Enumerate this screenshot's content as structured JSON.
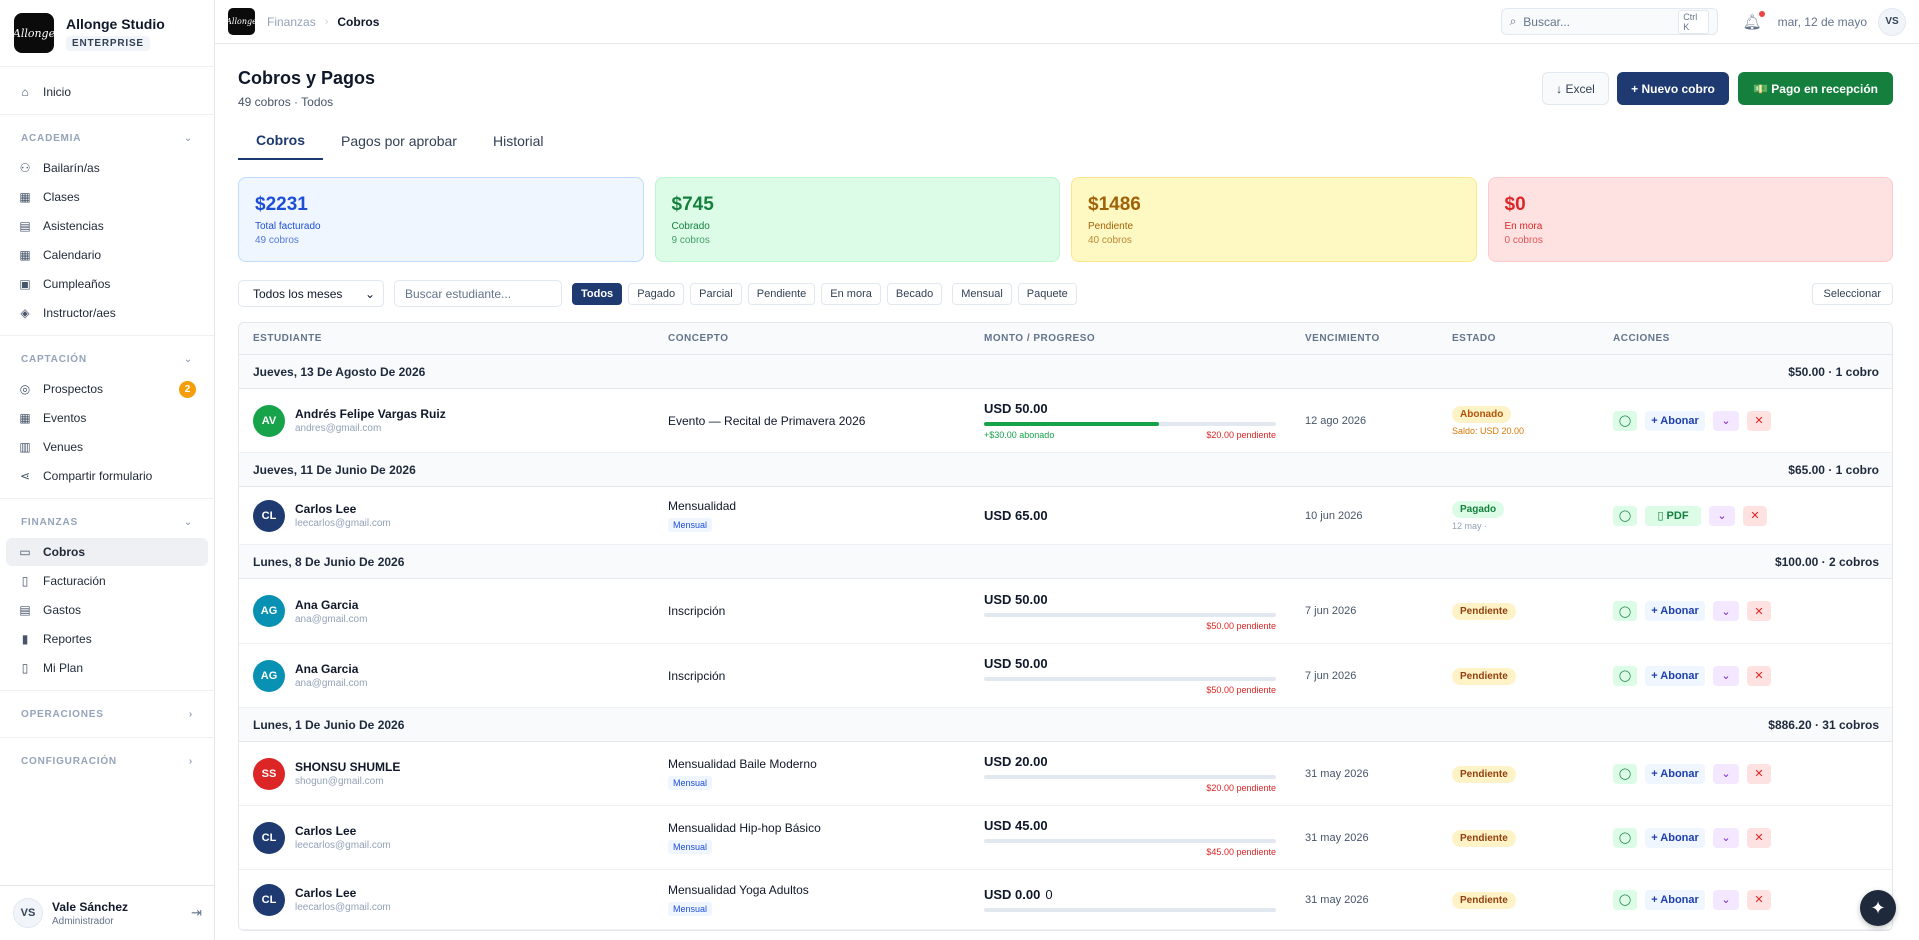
{
  "sidebar": {
    "brand": {
      "logo": "Allonge",
      "name": "Allonge Studio",
      "plan": "ENTERPRISE"
    },
    "home": "Inicio",
    "academia": {
      "title": "ACADEMIA",
      "items": [
        "Bailarín/as",
        "Clases",
        "Asistencias",
        "Calendario",
        "Cumpleaños",
        "Instructor/aes"
      ]
    },
    "captacion": {
      "title": "CAPTACIÓN",
      "items": [
        "Prospectos",
        "Eventos",
        "Venues",
        "Compartir formulario"
      ],
      "prospectos_badge": "2"
    },
    "finanzas": {
      "title": "FINANZAS",
      "items": [
        "Cobros",
        "Facturación",
        "Gastos",
        "Reportes",
        "Mi Plan"
      ]
    },
    "operaciones": "OPERACIONES",
    "configuracion": "CONFIGURACIÓN",
    "user": {
      "initials": "VS",
      "name": "Vale Sánchez",
      "role": "Administrador"
    }
  },
  "topbar": {
    "logo": "Allonge",
    "breadcrumb": [
      "Finanzas",
      "Cobros"
    ],
    "search_placeholder": "Buscar...",
    "shortcut": "Ctrl K",
    "date": "mar, 12 de mayo",
    "avatar": "VS"
  },
  "header": {
    "title": "Cobros y Pagos",
    "subtitle": "49 cobros · Todos",
    "excel": "↓ Excel",
    "new": "+ Nuevo cobro",
    "reception": "💵 Pago en recepción"
  },
  "tabs": [
    "Cobros",
    "Pagos por aprobar",
    "Historial"
  ],
  "cards": [
    {
      "amount": "$2231",
      "label": "Total facturado",
      "count": "49 cobros"
    },
    {
      "amount": "$745",
      "label": "Cobrado",
      "count": "9 cobros"
    },
    {
      "amount": "$1486",
      "label": "Pendiente",
      "count": "40 cobros"
    },
    {
      "amount": "$0",
      "label": "En mora",
      "count": "0 cobros"
    }
  ],
  "filters": {
    "month": "Todos los meses",
    "search_placeholder": "Buscar estudiante...",
    "chips": [
      "Todos",
      "Pagado",
      "Parcial",
      "Pendiente",
      "En mora",
      "Becado",
      "Mensual",
      "Paquete"
    ],
    "select": "Seleccionar"
  },
  "table": {
    "headers": [
      "ESTUDIANTE",
      "CONCEPTO",
      "MONTO / PROGRESO",
      "VENCIMIENTO",
      "ESTADO",
      "ACCIONES"
    ],
    "groups": [
      {
        "date": "Jueves, 13 De Agosto De 2026",
        "total": "$50.00 · 1 cobro"
      },
      {
        "date": "Jueves, 11 De Junio De 2026",
        "total": "$65.00 · 1 cobro"
      },
      {
        "date": "Lunes, 8 De Junio De 2026",
        "total": "$100.00 · 2 cobros"
      },
      {
        "date": "Lunes, 1 De Junio De 2026",
        "total": "$886.20 · 31 cobros"
      }
    ],
    "rows": [
      {
        "initials": "AV",
        "avatar_color": "#16a34a",
        "name": "Andrés Felipe Vargas Ruiz",
        "email": "andres@gmail.com",
        "concept": "Evento — Recital de Primavera 2026",
        "amount": "USD 50.00",
        "progress": 0.6,
        "paid": "+$30.00 abonado",
        "pending": "$20.00 pendiente",
        "due": "12 ago 2026",
        "status": "Abonado",
        "status_note": "Saldo: USD 20.00"
      },
      {
        "initials": "CL",
        "avatar_color": "#1e3a70",
        "name": "Carlos Lee",
        "email": "leecarlos@gmail.com",
        "concept": "Mensualidad",
        "tag": "Mensual",
        "amount": "USD 65.00",
        "due": "10 jun 2026",
        "status": "Pagado",
        "status_note": "12 may ·"
      },
      {
        "initials": "AG",
        "avatar_color": "#0891b2",
        "name": "Ana Garcia",
        "email": "ana@gmail.com",
        "concept": "Inscripción",
        "amount": "USD 50.00",
        "progress": 0,
        "pending": "$50.00 pendiente",
        "due": "7 jun 2026",
        "status": "Pendiente"
      },
      {
        "initials": "AG",
        "avatar_color": "#0891b2",
        "name": "Ana Garcia",
        "email": "ana@gmail.com",
        "concept": "Inscripción",
        "amount": "USD 50.00",
        "progress": 0,
        "pending": "$50.00 pendiente",
        "due": "7 jun 2026",
        "status": "Pendiente"
      },
      {
        "initials": "SS",
        "avatar_color": "#dc2626",
        "name": "SHONSU SHUMLE",
        "email": "shogun@gmail.com",
        "concept": "Mensualidad Baile Moderno",
        "tag": "Mensual",
        "amount": "USD 20.00",
        "progress": 0,
        "pending": "$20.00 pendiente",
        "due": "31 may 2026",
        "status": "Pendiente"
      },
      {
        "initials": "CL",
        "avatar_color": "#1e3a70",
        "name": "Carlos Lee",
        "email": "leecarlos@gmail.com",
        "concept": "Mensualidad Hip-hop Básico",
        "tag": "Mensual",
        "amount": "USD 45.00",
        "progress": 0,
        "pending": "$45.00 pendiente",
        "due": "31 may 2026",
        "status": "Pendiente"
      },
      {
        "initials": "CL",
        "avatar_color": "#1e3a70",
        "name": "Carlos Lee",
        "email": "leecarlos@gmail.com",
        "concept": "Mensualidad Yoga Adultos",
        "tag": "Mensual",
        "amount": "USD 0.00",
        "amount_extra": "0",
        "progress": 0,
        "due": "31 may 2026",
        "status": "Pendiente"
      }
    ],
    "actions": {
      "abonar": "+ Abonar",
      "pdf": "PDF"
    }
  }
}
